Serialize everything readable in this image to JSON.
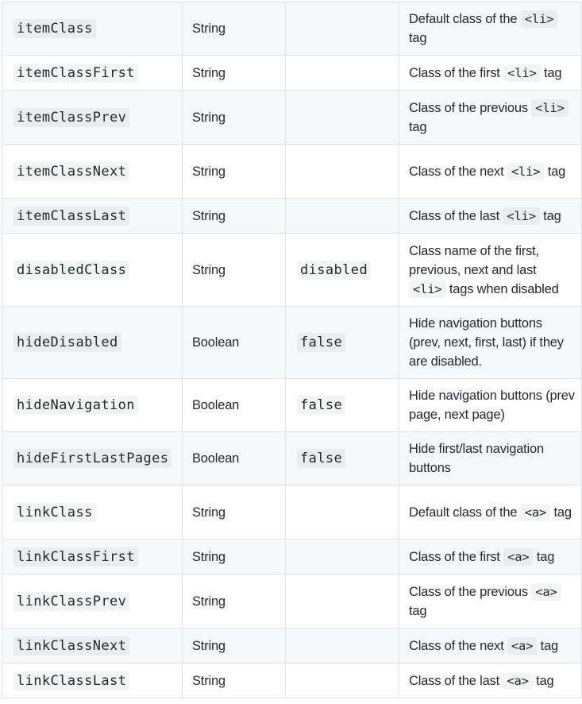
{
  "rows": [
    {
      "name": "itemClass",
      "type": "String",
      "default": "",
      "desc": [
        {
          "t": "Default class of the "
        },
        {
          "c": "<li>"
        },
        {
          "t": " tag"
        }
      ]
    },
    {
      "name": "itemClassFirst",
      "type": "String",
      "default": "",
      "desc": [
        {
          "t": "Class of the first "
        },
        {
          "c": "<li>"
        },
        {
          "t": " tag"
        }
      ]
    },
    {
      "name": "itemClassPrev",
      "type": "String",
      "default": "",
      "desc": [
        {
          "t": "Class of the previous "
        },
        {
          "c": "<li>"
        },
        {
          "t": " tag"
        }
      ]
    },
    {
      "name": "itemClassNext",
      "type": "String",
      "default": "",
      "desc": [
        {
          "t": "Class of the next "
        },
        {
          "c": "<li>"
        },
        {
          "t": " tag"
        }
      ]
    },
    {
      "name": "itemClassLast",
      "type": "String",
      "default": "",
      "desc": [
        {
          "t": "Class of the last "
        },
        {
          "c": "<li>"
        },
        {
          "t": " tag"
        }
      ]
    },
    {
      "name": "disabledClass",
      "type": "String",
      "default": "disabled",
      "desc": [
        {
          "t": "Class name of the first, previous, next and last "
        },
        {
          "c": "<li>"
        },
        {
          "t": " tags when disabled"
        }
      ]
    },
    {
      "name": "hideDisabled",
      "type": "Boolean",
      "default": "false",
      "desc": [
        {
          "t": "Hide navigation buttons (prev, next, first, last) if they are disabled."
        }
      ]
    },
    {
      "name": "hideNavigation",
      "type": "Boolean",
      "default": "false",
      "desc": [
        {
          "t": "Hide navigation buttons (prev page, next page)"
        }
      ]
    },
    {
      "name": "hideFirstLastPages",
      "type": "Boolean",
      "default": "false",
      "desc": [
        {
          "t": "Hide first/last navigation buttons"
        }
      ]
    },
    {
      "name": "linkClass",
      "type": "String",
      "default": "",
      "desc": [
        {
          "t": "Default class of the "
        },
        {
          "c": "<a>"
        },
        {
          "t": " tag"
        }
      ]
    },
    {
      "name": "linkClassFirst",
      "type": "String",
      "default": "",
      "desc": [
        {
          "t": "Class of the first "
        },
        {
          "c": "<a>"
        },
        {
          "t": " tag"
        }
      ]
    },
    {
      "name": "linkClassPrev",
      "type": "String",
      "default": "",
      "desc": [
        {
          "t": "Class of the previous "
        },
        {
          "c": "<a>"
        },
        {
          "t": " tag"
        }
      ]
    },
    {
      "name": "linkClassNext",
      "type": "String",
      "default": "",
      "desc": [
        {
          "t": "Class of the next "
        },
        {
          "c": "<a>"
        },
        {
          "t": " tag"
        }
      ]
    },
    {
      "name": "linkClassLast",
      "type": "String",
      "default": "",
      "desc": [
        {
          "t": "Class of the last "
        },
        {
          "c": "<a>"
        },
        {
          "t": " tag"
        }
      ]
    }
  ]
}
